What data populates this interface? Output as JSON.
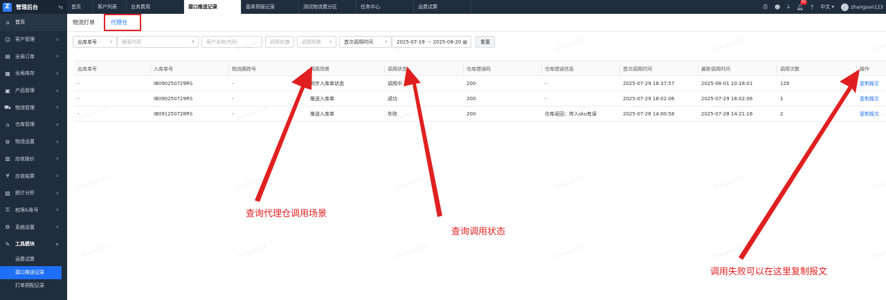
{
  "brand": {
    "title": "管理后台"
  },
  "sidebar": {
    "items": [
      {
        "label": "首页",
        "icon": "home-icon",
        "glyph": "⌂"
      },
      {
        "label": "客户管理",
        "icon": "users-icon",
        "glyph": "☺"
      },
      {
        "label": "全局订单",
        "icon": "order-icon",
        "glyph": "▤"
      },
      {
        "label": "全局库存",
        "icon": "inventory-icon",
        "glyph": "▦"
      },
      {
        "label": "产品管理",
        "icon": "product-icon",
        "glyph": "▣"
      },
      {
        "label": "物流管理",
        "icon": "truck-icon",
        "glyph": "⛟"
      },
      {
        "label": "仓库管理",
        "icon": "warehouse-icon",
        "glyph": "⌂"
      },
      {
        "label": "物流设置",
        "icon": "settings-icon",
        "glyph": "⚙"
      },
      {
        "label": "应收报价",
        "icon": "quote-icon",
        "glyph": "▥"
      },
      {
        "label": "应收结算",
        "icon": "money-icon",
        "glyph": "¥"
      },
      {
        "label": "统计分析",
        "icon": "chart-icon",
        "glyph": "▧"
      },
      {
        "label": "权限&账号",
        "icon": "key-icon",
        "glyph": "⚿"
      },
      {
        "label": "系统设置",
        "icon": "gear-icon",
        "glyph": "⚙"
      },
      {
        "label": "工具模块",
        "icon": "tool-icon",
        "glyph": "✎"
      }
    ],
    "sub_items": [
      {
        "label": "运费试算"
      },
      {
        "label": "接口推送记录"
      },
      {
        "label": "打单预配记录"
      }
    ]
  },
  "topbar": {
    "tabs": [
      {
        "label": "首页"
      },
      {
        "label": "客户列表"
      },
      {
        "label": "业务费用"
      },
      {
        "label": "接口推送记录"
      },
      {
        "label": "面单预报记录"
      },
      {
        "label": "测试物流费分区"
      },
      {
        "label": "任务中心"
      },
      {
        "label": "运费试算"
      }
    ],
    "notification_count": "52",
    "language": "中文",
    "username": "zhangsan123"
  },
  "subtabs": [
    {
      "label": "物流打单"
    },
    {
      "label": "代理仓"
    }
  ],
  "filters": {
    "field_select": "出库单号",
    "search_placeholder": "搜索内容",
    "customer_placeholder": "客户名称/代码",
    "status_placeholder": "调用状态",
    "scene_placeholder": "调用场景",
    "time_select": "首次调用时间",
    "date_start": "2025-07-19",
    "date_arrow": "→",
    "date_end": "2025-08-20",
    "reset_label": "重置"
  },
  "table": {
    "columns": [
      "出库单号",
      "入库单号",
      "物流跟踪号",
      "调用场景",
      "调用状态",
      "仓库错误码",
      "仓库错误信息",
      "首次调用时间",
      "最新调用时间",
      "调用次数",
      "操作"
    ],
    "rows": [
      [
        "-",
        "IB090250729RS",
        "-",
        "同步入库单状态",
        "调用中",
        "200",
        "-",
        "2025-07-29 18:37:57",
        "2025-08-01 10:18:01",
        "129",
        "复制报文"
      ],
      [
        "-",
        "IB090250729RS",
        "-",
        "推送入库单",
        "成功",
        "200",
        "-",
        "2025-07-29 18:02:06",
        "2025-07-29 18:02:06",
        "1",
        "复制报文"
      ],
      [
        "-",
        "IB091250728RS",
        "-",
        "推送入库单",
        "失败",
        "200",
        "仓库返回：传入sku有误",
        "2025-07-28 14:00:58",
        "2025-07-28 14:21:16",
        "2",
        "复制报文"
      ]
    ]
  },
  "annotations": {
    "note1": "查询代理仓调用场景",
    "note2": "查询调用状态",
    "note3": "调用失败可以在这里复制报文",
    "accent": "#e02020"
  },
  "watermark": "zhangsan123",
  "colors": {
    "sidebar_bg": "#1f2d3d",
    "primary": "#1e6ff5",
    "annotation": "#e02020"
  }
}
